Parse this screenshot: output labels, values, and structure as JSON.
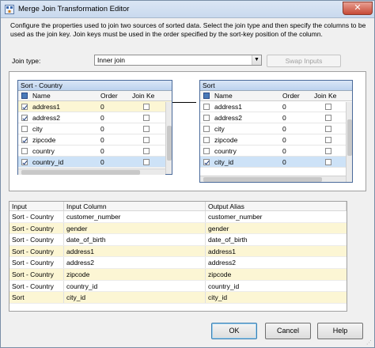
{
  "window": {
    "title": "Merge Join Transformation Editor",
    "close_glyph": "✕"
  },
  "description": "Configure the properties used to join two sources of sorted data. Select the join type and then specify the columns to be used as the join key. Join keys must be used in the order specified by the sort-key position of the column.",
  "join": {
    "label": "Join type:",
    "value": "Inner join",
    "swap_label": "Swap Inputs"
  },
  "left_table": {
    "title": "Sort - Country",
    "headers": [
      "Name",
      "Order",
      "Join Ke"
    ],
    "rows": [
      {
        "name": "address1",
        "order": "0",
        "checked": true,
        "key": true
      },
      {
        "name": "address2",
        "order": "0",
        "checked": true,
        "key": false
      },
      {
        "name": "city",
        "order": "0",
        "checked": false,
        "key": false
      },
      {
        "name": "zipcode",
        "order": "0",
        "checked": true,
        "key": false
      },
      {
        "name": "country",
        "order": "0",
        "checked": false,
        "key": false
      },
      {
        "name": "country_id",
        "order": "0",
        "checked": true,
        "key": false
      }
    ]
  },
  "right_table": {
    "title": "Sort",
    "headers": [
      "Name",
      "Order",
      "Join Ke"
    ],
    "rows": [
      {
        "name": "address1",
        "order": "0",
        "checked": false,
        "key": false
      },
      {
        "name": "address2",
        "order": "0",
        "checked": false,
        "key": false
      },
      {
        "name": "city",
        "order": "0",
        "checked": false,
        "key": false
      },
      {
        "name": "zipcode",
        "order": "0",
        "checked": false,
        "key": false
      },
      {
        "name": "country",
        "order": "0",
        "checked": false,
        "key": false
      },
      {
        "name": "city_id",
        "order": "0",
        "checked": true,
        "key": false
      }
    ]
  },
  "grid": {
    "headers": [
      "Input",
      "Input Column",
      "Output Alias"
    ],
    "rows": [
      [
        "Sort - Country",
        "customer_number",
        "customer_number"
      ],
      [
        "Sort - Country",
        "gender",
        "gender"
      ],
      [
        "Sort - Country",
        "date_of_birth",
        "date_of_birth"
      ],
      [
        "Sort - Country",
        "address1",
        "address1"
      ],
      [
        "Sort - Country",
        "address2",
        "address2"
      ],
      [
        "Sort - Country",
        "zipcode",
        "zipcode"
      ],
      [
        "Sort - Country",
        "country_id",
        "country_id"
      ],
      [
        "Sort",
        "city_id",
        "city_id"
      ]
    ]
  },
  "buttons": {
    "ok": "OK",
    "cancel": "Cancel",
    "help": "Help"
  }
}
